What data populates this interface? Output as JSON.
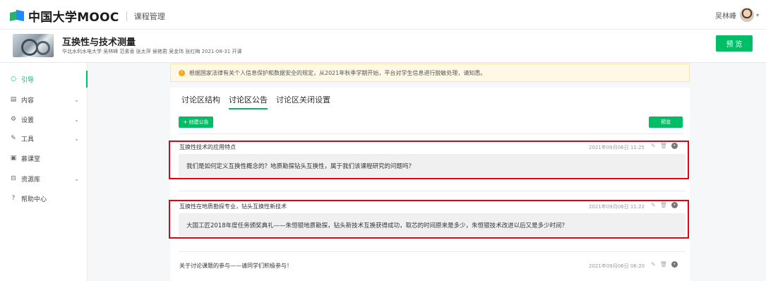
{
  "header": {
    "logo_text": "中国大学MOOC",
    "section": "课程管理",
    "user_name": "吴林峰"
  },
  "course": {
    "title": "互换性与技术测量",
    "meta": "华北水利水电大学 吴林峰 范素香 张太萍 侯艳君 吴金玮 张红梅 2021-08-31 开课",
    "preview_label": "预 览"
  },
  "sidebar": {
    "items": [
      {
        "icon": "○",
        "label": "引导",
        "has_chevron": false
      },
      {
        "icon": "▤",
        "label": "内容",
        "has_chevron": true
      },
      {
        "icon": "⚙",
        "label": "设置",
        "has_chevron": true
      },
      {
        "icon": "✎",
        "label": "工具",
        "has_chevron": true
      },
      {
        "icon": "▣",
        "label": "慕课堂",
        "has_chevron": false
      },
      {
        "icon": "⊟",
        "label": "资源库",
        "has_chevron": true
      },
      {
        "icon": "?",
        "label": "帮助中心",
        "has_chevron": false
      }
    ],
    "chevron": "⌄"
  },
  "notice": {
    "icon": "!",
    "text": "根据国家法律有关个人信息保护和数据安全的规定，从2021年秋季学期开始，平台对学生信息进行脱敏处理，请知悉。"
  },
  "tabs": [
    "讨论区结构",
    "讨论区公告",
    "讨论区关闭设置"
  ],
  "toolbar": {
    "create_label": "+ 创建公告",
    "preview_label": "预览"
  },
  "posts": [
    {
      "title": "互换性技术的应用特点",
      "date": "2021年09月06日 11:25",
      "body": "我们是如何定义互换性概念的？地质勘探钻头互换性，属于我们该课程研究的问题吗？"
    },
    {
      "title": "互换性在地质勘探专业，钻头互换性新技术",
      "date": "2021年09月06日 11:22",
      "body": "大国工匠2018年度任务颁奖典礼——朱恒银地质勘探，钻头新技术互换获得成功，取芯的时间原来是多少，朱恒银技术改进以后又是多少时间？"
    },
    {
      "title": "关于讨论课题的参与——请同学们积极参与！",
      "date": "2021年09月06日 06:20",
      "body": ""
    }
  ],
  "icons": {
    "edit": "✎",
    "delete": "🗑",
    "more": "•"
  },
  "colors": {
    "accent": "#00be68",
    "highlight": "#e60012",
    "notice_bg": "#fff8e5"
  }
}
